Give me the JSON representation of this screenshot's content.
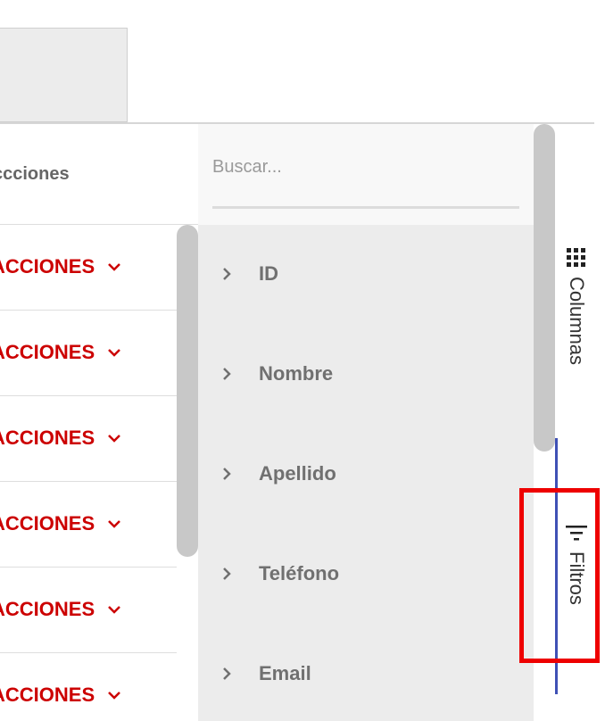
{
  "grid": {
    "header_label": "ccciones",
    "row_action_label": "ACCIONES",
    "rows": [
      {
        "action": "ACCIONES"
      },
      {
        "action": "ACCIONES"
      },
      {
        "action": "ACCIONES"
      },
      {
        "action": "ACCIONES"
      },
      {
        "action": "ACCIONES"
      },
      {
        "action": "ACCIONES"
      }
    ]
  },
  "tool_panel": {
    "search": {
      "placeholder": "Buscar...",
      "value": ""
    },
    "columns": [
      {
        "label": "ID"
      },
      {
        "label": "Nombre"
      },
      {
        "label": "Apellido"
      },
      {
        "label": "Teléfono"
      },
      {
        "label": "Email"
      }
    ]
  },
  "side_tabs": {
    "columnas": {
      "label": "Columnas",
      "icon": "grid-icon"
    },
    "filtros": {
      "label": "Filtros",
      "icon": "filter-icon"
    }
  },
  "colors": {
    "accent_red": "#cc0000",
    "focus_red": "#ee0000",
    "indicator_blue": "#3f51b5"
  }
}
